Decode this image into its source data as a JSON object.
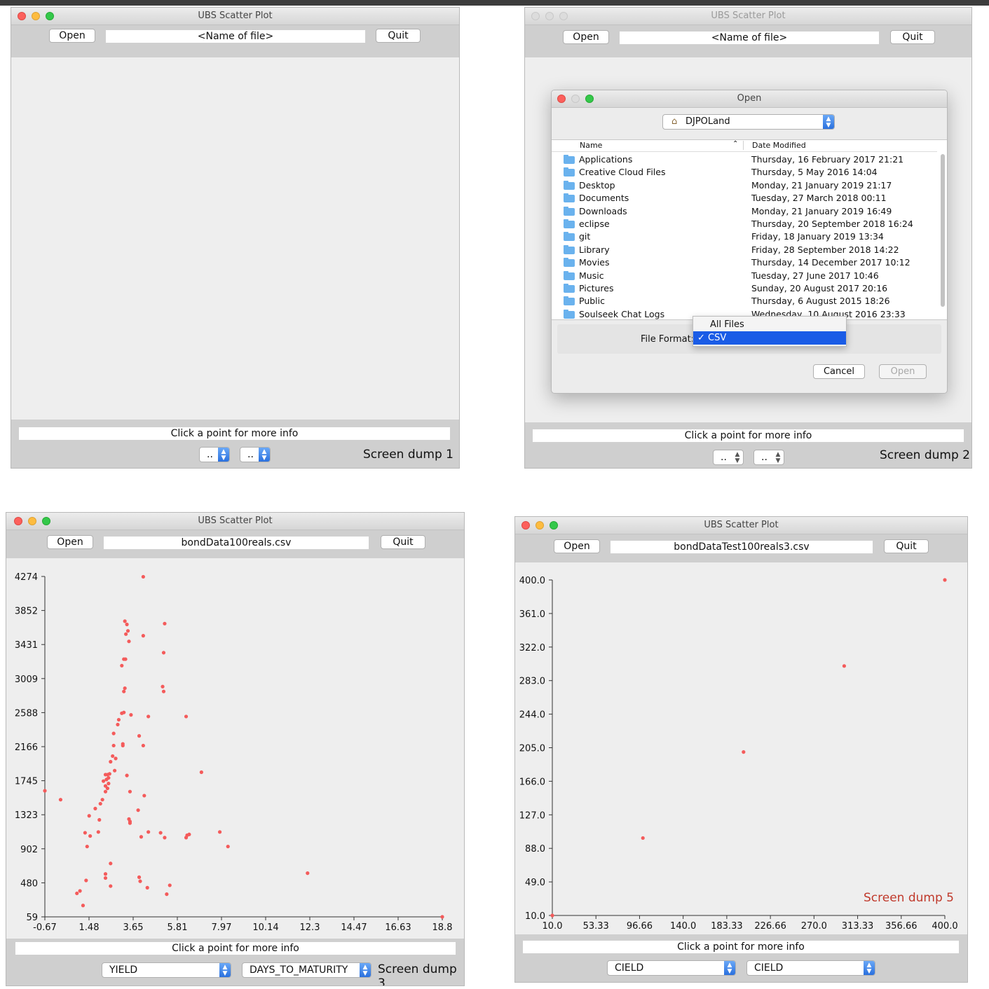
{
  "app_title": "UBS Scatter Plot",
  "open_label": "Open",
  "quit_label": "Quit",
  "info_text": "Click a point for more info",
  "placeholder_select": "..",
  "w1": {
    "file_name": "<Name of file>",
    "dump_label": "Screen dump 1"
  },
  "w2": {
    "file_name": "<Name of file>",
    "dump_label": "Screen dump 2",
    "dialog": {
      "title": "Open",
      "location": "DJPOLand",
      "col_name": "Name",
      "col_date": "Date Modified",
      "files": [
        {
          "name": "Applications",
          "date": "Thursday, 16 February 2017 21:21"
        },
        {
          "name": "Creative Cloud Files",
          "date": "Thursday, 5 May 2016 14:04"
        },
        {
          "name": "Desktop",
          "date": "Monday, 21 January 2019 21:17"
        },
        {
          "name": "Documents",
          "date": "Tuesday, 27 March 2018 00:11"
        },
        {
          "name": "Downloads",
          "date": "Monday, 21 January 2019 16:49"
        },
        {
          "name": "eclipse",
          "date": "Thursday, 20 September 2018 16:24"
        },
        {
          "name": "git",
          "date": "Friday, 18 January 2019 13:34"
        },
        {
          "name": "Library",
          "date": "Friday, 28 September 2018 14:22"
        },
        {
          "name": "Movies",
          "date": "Thursday, 14 December 2017 10:12"
        },
        {
          "name": "Music",
          "date": "Tuesday, 27 June 2017 10:46"
        },
        {
          "name": "Pictures",
          "date": "Sunday, 20 August 2017 20:16"
        },
        {
          "name": "Public",
          "date": "Thursday, 6 August 2015 18:26"
        },
        {
          "name": "Soulseek Chat Logs",
          "date": "Wednesday, 10 August 2016 23:33"
        }
      ],
      "file_format_label": "File Format:",
      "format_options": [
        "All Files",
        "CSV"
      ],
      "format_selected": "✓ CSV",
      "cancel_label": "Cancel",
      "open_label": "Open"
    }
  },
  "w3": {
    "file_name": "bondData100reals.csv",
    "dump_label": "Screen dump 3",
    "x_select": "YIELD",
    "y_select": "DAYS_TO_MATURITY"
  },
  "w4": {
    "file_name": "bondDataTest100reals3.csv",
    "dump_label": "Screen dump 5",
    "x_select": "CIELD",
    "y_select": "CIELD"
  },
  "colors": {
    "point": "#f45b5b",
    "dump5": "#c0392b",
    "select_arrow": "#2a70de"
  },
  "chart_data": [
    {
      "type": "scatter",
      "xlim": [
        -0.67,
        18.8
      ],
      "ylim": [
        59,
        4274
      ],
      "x_ticks": [
        "-0.67",
        "1.48",
        "3.65",
        "5.81",
        "7.97",
        "10.14",
        "12.3",
        "14.47",
        "16.63",
        "18.8"
      ],
      "y_ticks": [
        "59",
        "480",
        "902",
        "1323",
        "1745",
        "2166",
        "2588",
        "3009",
        "3431",
        "3852",
        "4274"
      ],
      "points": [
        [
          -0.67,
          1620
        ],
        [
          0.1,
          1510
        ],
        [
          4.15,
          4270
        ],
        [
          3.25,
          3720
        ],
        [
          3.35,
          3680
        ],
        [
          3.4,
          3600
        ],
        [
          3.3,
          3560
        ],
        [
          3.45,
          3470
        ],
        [
          4.15,
          3540
        ],
        [
          5.2,
          3690
        ],
        [
          5.15,
          3330
        ],
        [
          3.28,
          3250
        ],
        [
          3.2,
          3250
        ],
        [
          3.1,
          3170
        ],
        [
          3.25,
          2890
        ],
        [
          3.2,
          2850
        ],
        [
          5.1,
          2910
        ],
        [
          5.15,
          2850
        ],
        [
          3.2,
          2590
        ],
        [
          3.1,
          2580
        ],
        [
          3.55,
          2560
        ],
        [
          4.4,
          2540
        ],
        [
          6.25,
          2540
        ],
        [
          2.95,
          2500
        ],
        [
          2.9,
          2440
        ],
        [
          2.7,
          2330
        ],
        [
          3.95,
          2300
        ],
        [
          4.15,
          2180
        ],
        [
          3.15,
          2200
        ],
        [
          3.15,
          2180
        ],
        [
          2.7,
          2180
        ],
        [
          2.65,
          2050
        ],
        [
          2.8,
          2020
        ],
        [
          2.55,
          1980
        ],
        [
          2.75,
          1870
        ],
        [
          2.5,
          1830
        ],
        [
          2.4,
          1820
        ],
        [
          2.3,
          1820
        ],
        [
          2.45,
          1780
        ],
        [
          2.35,
          1760
        ],
        [
          2.2,
          1740
        ],
        [
          3.35,
          1810
        ],
        [
          7.0,
          1850
        ],
        [
          2.45,
          1710
        ],
        [
          2.3,
          1680
        ],
        [
          2.4,
          1650
        ],
        [
          2.3,
          1610
        ],
        [
          3.5,
          1610
        ],
        [
          4.2,
          1560
        ],
        [
          2.15,
          1510
        ],
        [
          2.05,
          1460
        ],
        [
          1.8,
          1400
        ],
        [
          3.9,
          1380
        ],
        [
          3.45,
          1270
        ],
        [
          3.5,
          1240
        ],
        [
          3.5,
          1220
        ],
        [
          1.5,
          1310
        ],
        [
          2.0,
          1260
        ],
        [
          1.3,
          1100
        ],
        [
          1.55,
          1060
        ],
        [
          1.95,
          1110
        ],
        [
          4.4,
          1110
        ],
        [
          4.05,
          1050
        ],
        [
          5.0,
          1100
        ],
        [
          5.2,
          1040
        ],
        [
          6.3,
          1070
        ],
        [
          6.4,
          1080
        ],
        [
          6.25,
          1040
        ],
        [
          7.9,
          1110
        ],
        [
          8.3,
          930
        ],
        [
          1.4,
          930
        ],
        [
          2.55,
          720
        ],
        [
          2.3,
          590
        ],
        [
          2.3,
          540
        ],
        [
          1.35,
          510
        ],
        [
          3.95,
          550
        ],
        [
          4.0,
          500
        ],
        [
          12.2,
          600
        ],
        [
          2.55,
          440
        ],
        [
          4.35,
          420
        ],
        [
          5.45,
          450
        ],
        [
          5.3,
          340
        ],
        [
          1.05,
          380
        ],
        [
          0.9,
          350
        ],
        [
          1.2,
          200
        ],
        [
          18.8,
          59
        ]
      ]
    },
    {
      "type": "scatter",
      "xlim": [
        10.0,
        400.0
      ],
      "ylim": [
        10.0,
        400.0
      ],
      "x_ticks": [
        "10.0",
        "53.33",
        "96.66",
        "140.0",
        "183.33",
        "226.66",
        "270.0",
        "313.33",
        "356.66",
        "400.0"
      ],
      "y_ticks": [
        "10.0",
        "49.0",
        "88.0",
        "127.0",
        "166.0",
        "205.0",
        "244.0",
        "283.0",
        "322.0",
        "361.0",
        "400.0"
      ],
      "points": [
        [
          10,
          10
        ],
        [
          100,
          100
        ],
        [
          200,
          200
        ],
        [
          300,
          300
        ],
        [
          400,
          400
        ]
      ]
    }
  ]
}
